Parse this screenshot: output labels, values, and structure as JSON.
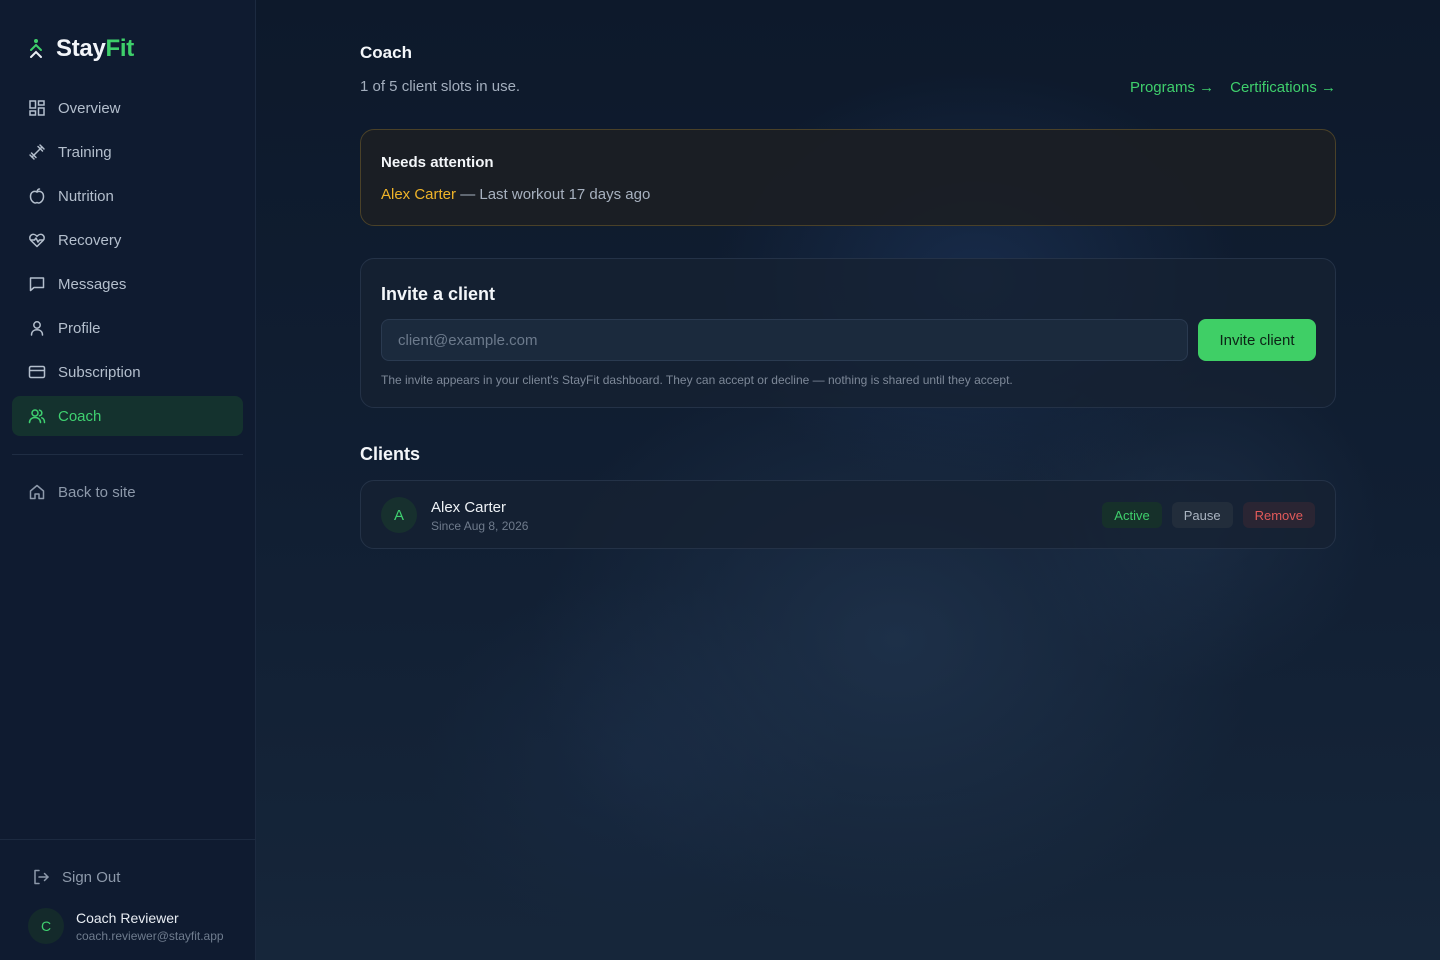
{
  "brand": {
    "name_part1": "Stay",
    "name_part2": "Fit",
    "accent": "#3ecf6a"
  },
  "sidebar": {
    "items": [
      {
        "label": "Overview",
        "icon": "grid-icon"
      },
      {
        "label": "Training",
        "icon": "dumbbell-icon"
      },
      {
        "label": "Nutrition",
        "icon": "apple-icon"
      },
      {
        "label": "Recovery",
        "icon": "heart-pulse-icon"
      },
      {
        "label": "Messages",
        "icon": "message-icon"
      },
      {
        "label": "Profile",
        "icon": "user-icon"
      },
      {
        "label": "Subscription",
        "icon": "credit-card-icon"
      },
      {
        "label": "Coach",
        "icon": "users-icon",
        "active": true
      }
    ],
    "back_label": "Back to site",
    "signout_label": "Sign Out",
    "user": {
      "initial": "C",
      "name": "Coach Reviewer",
      "email": "coach.reviewer@stayfit.app"
    }
  },
  "page": {
    "title": "Coach",
    "subtitle": "1 of 5 client slots in use.",
    "links": {
      "programs": "Programs →",
      "certifications": "Certifications →"
    }
  },
  "attention": {
    "title": "Needs attention",
    "client_name": "Alex Carter",
    "detail": " — Last workout 17 days ago"
  },
  "invite": {
    "title": "Invite a client",
    "placeholder": "client@example.com",
    "button_label": "Invite client",
    "note": "The invite appears in your client's StayFit dashboard. They can accept or decline — nothing is shared until they accept."
  },
  "clients": {
    "heading": "Clients",
    "rows": [
      {
        "initial": "A",
        "name": "Alex Carter",
        "since": "Since Aug 8, 2026",
        "status": "Active",
        "pause_label": "Pause",
        "remove_label": "Remove"
      }
    ]
  },
  "colors": {
    "active_green": "#3fcf6c",
    "warning_amber": "#f0b429",
    "danger_red": "#e25a5a"
  }
}
